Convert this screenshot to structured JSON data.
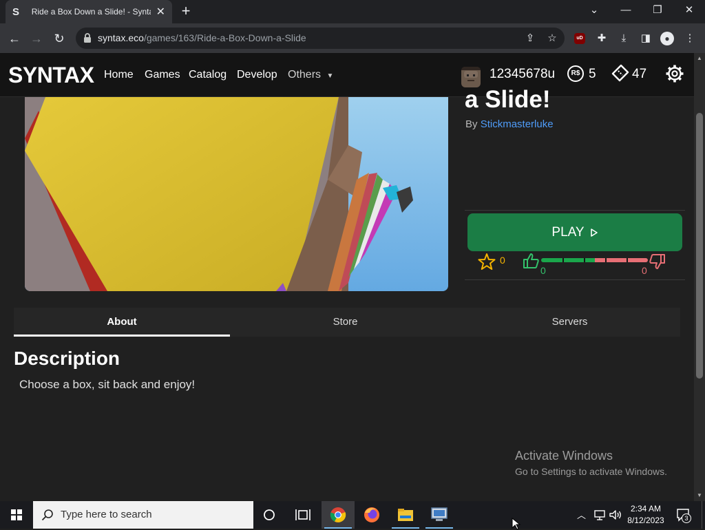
{
  "browser": {
    "tab": {
      "favicon_letter": "S",
      "title": "Ride a Box Down a Slide! - Syntax"
    },
    "url_host": "syntax.eco",
    "url_path": "/games/163/Ride-a-Box-Down-a-Slide",
    "extension_badge": "uD"
  },
  "site": {
    "logo": "SYNTAX",
    "nav": {
      "home": "Home",
      "games": "Games",
      "catalog": "Catalog",
      "develop": "Develop",
      "others": "Others"
    },
    "user": {
      "name": "12345678u",
      "robux": "5",
      "tix": "47",
      "robux_icon_label": "R$"
    }
  },
  "game": {
    "title": "a Slide!",
    "by_prefix": "By",
    "creator": "Stickmasterluke",
    "play_label": "PLAY",
    "favorites": "0",
    "likes": "0",
    "dislikes": "0",
    "like_ratio": 0.5
  },
  "tabs": {
    "about": "About",
    "store": "Store",
    "servers": "Servers"
  },
  "description": {
    "heading": "Description",
    "body": "Choose a box, sit back and enjoy!"
  },
  "watermark": {
    "line1": "Activate Windows",
    "line2": "Go to Settings to activate Windows."
  },
  "taskbar": {
    "search_placeholder": "Type here to search",
    "time": "2:34 AM",
    "date": "8/12/2023",
    "notifications": "3"
  },
  "colors": {
    "accent_play": "#1b7d45",
    "link": "#4f9cf9",
    "like": "#33c26b",
    "dislike": "#e76f75",
    "favorite": "#f5b400"
  }
}
